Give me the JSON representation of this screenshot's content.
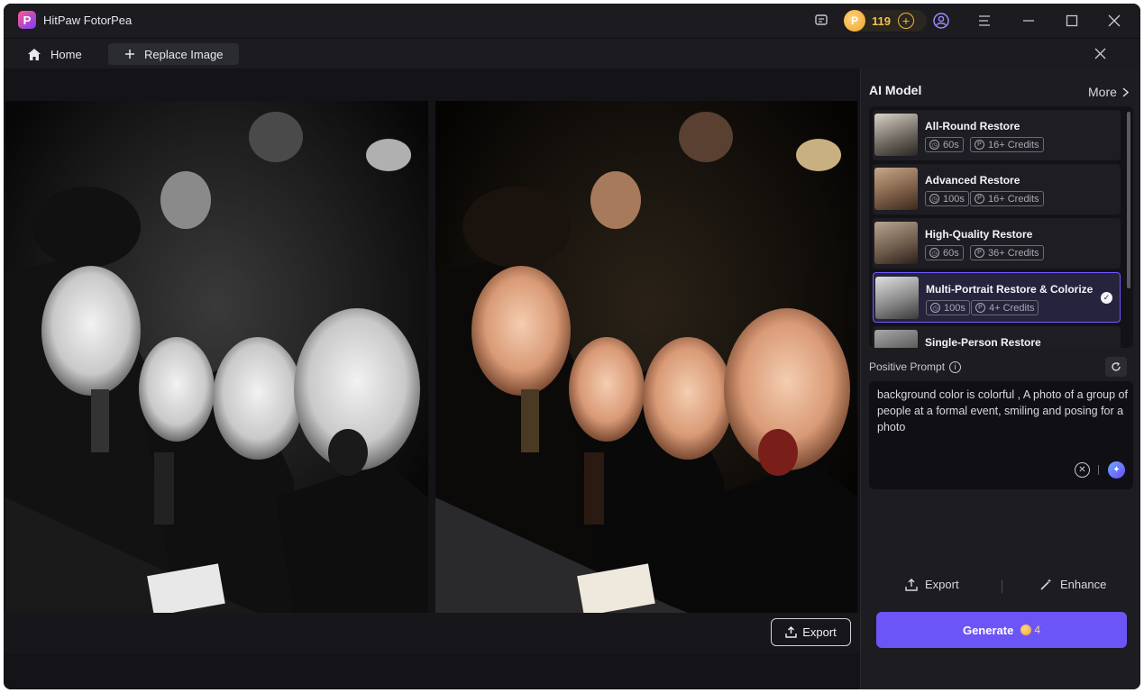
{
  "app": {
    "title": "HitPaw FotorPea",
    "logo_letter": "P"
  },
  "titlebar": {
    "credits": "119",
    "icons": [
      "message-icon",
      "coin-icon",
      "add-credits-icon",
      "account-icon",
      "menu-icon",
      "minimize-icon",
      "maximize-icon",
      "close-icon"
    ]
  },
  "tabs": {
    "home": "Home",
    "replace": "Replace Image"
  },
  "canvas": {
    "export_label": "Export"
  },
  "panel": {
    "ai_model_title": "AI Model",
    "more_label": "More",
    "models": [
      {
        "name": "All-Round Restore",
        "time": "60s",
        "credits": "16+ Credits",
        "selected": false
      },
      {
        "name": "Advanced Restore",
        "time": "100s",
        "credits": "16+ Credits",
        "selected": false
      },
      {
        "name": "High-Quality Restore",
        "time": "60s",
        "credits": "36+ Credits",
        "selected": false
      },
      {
        "name": "Multi-Portrait Restore & Colorize",
        "time": "100s",
        "credits": "4+ Credits",
        "selected": true
      },
      {
        "name": "Single-Person Restore",
        "time": "",
        "credits": "",
        "selected": false
      }
    ],
    "prompt_label": "Positive Prompt",
    "prompt_text": "background color is colorful , A   photo of a group of people at a formal event, smiling and posing for a photo",
    "export_label": "Export",
    "enhance_label": "Enhance",
    "generate_label": "Generate",
    "generate_cost": "4"
  },
  "colors": {
    "accent": "#6b55f6",
    "gold": "#f5b43a",
    "background": "#18181d"
  }
}
